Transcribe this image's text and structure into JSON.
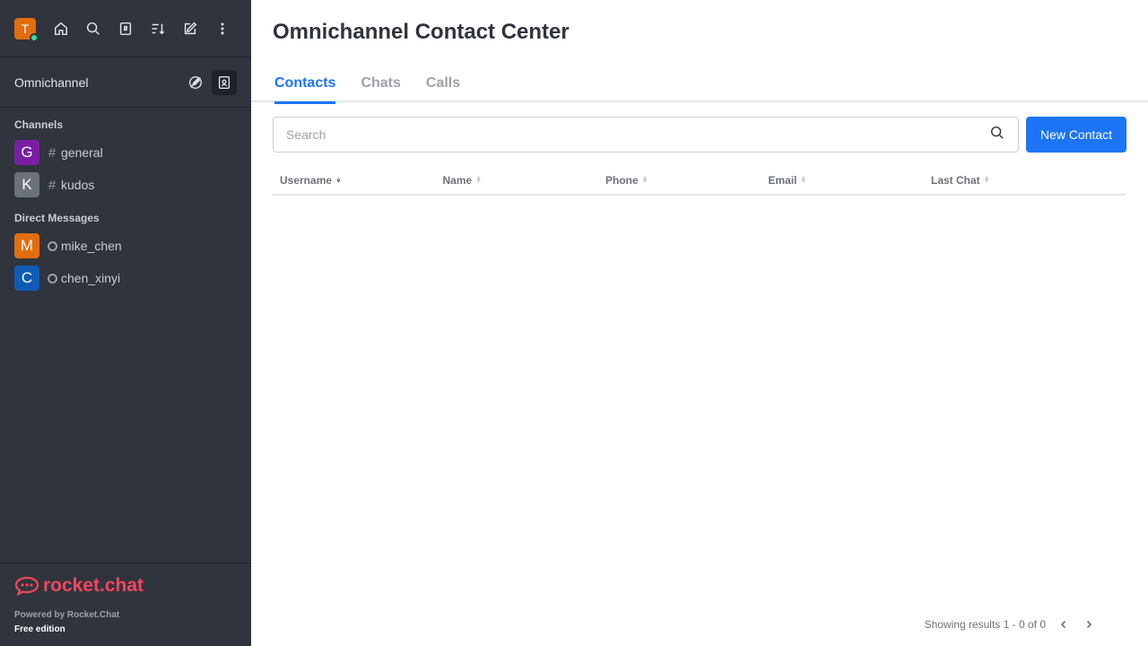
{
  "colors": {
    "accent": "#1d74f5",
    "sidebar_bg": "#2f343d",
    "brand": "#f5455c",
    "online": "#2de0a5"
  },
  "user": {
    "initial": "T",
    "avatar_color": "#e26d0e",
    "status": "online"
  },
  "topbar": {
    "icons": [
      "home-icon",
      "search-icon",
      "directory-icon",
      "sort-icon",
      "create-new-icon",
      "kebab-menu-icon"
    ]
  },
  "sidebar": {
    "section_title": "Omnichannel",
    "channels_label": "Channels",
    "channels": [
      {
        "initial": "G",
        "name": "general",
        "avatar_color": "#7b1fa2"
      },
      {
        "initial": "K",
        "name": "kudos",
        "avatar_color": "#6c727a"
      }
    ],
    "dm_label": "Direct Messages",
    "dms": [
      {
        "initial": "M",
        "name": "mike_chen",
        "avatar_color": "#e26d0e"
      },
      {
        "initial": "C",
        "name": "chen_xinyi",
        "avatar_color": "#0f5bb5"
      }
    ],
    "footer": {
      "brand": "rocket.chat",
      "powered": "Powered by Rocket.Chat",
      "edition": "Free edition"
    }
  },
  "main": {
    "title": "Omnichannel Contact Center",
    "tabs": [
      {
        "label": "Contacts",
        "active": true
      },
      {
        "label": "Chats",
        "active": false
      },
      {
        "label": "Calls",
        "active": false
      }
    ],
    "search": {
      "placeholder": "Search",
      "value": ""
    },
    "new_contact_label": "New Contact",
    "columns": [
      "Username",
      "Name",
      "Phone",
      "Email",
      "Last Chat"
    ],
    "rows": [],
    "pagination": "Showing results 1 - 0 of 0"
  }
}
